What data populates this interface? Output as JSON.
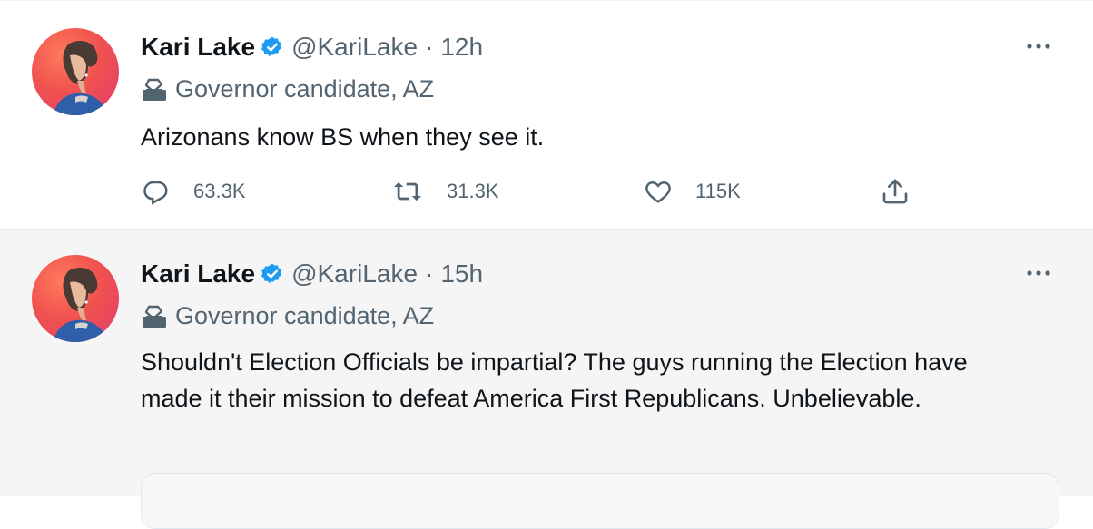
{
  "tweets": [
    {
      "name": "Kari Lake",
      "handle": "@KariLake",
      "separator": "·",
      "time": "12h",
      "label": "Governor candidate, AZ",
      "text": "Arizonans know BS when they see it.",
      "actions": {
        "replies": "63.3K",
        "retweets": "31.3K",
        "likes": "115K"
      }
    },
    {
      "name": "Kari Lake",
      "handle": "@KariLake",
      "separator": "·",
      "time": "15h",
      "label": "Governor candidate, AZ",
      "text": "Shouldn't Election Officials be impartial? The guys running the Election have made it their mission to defeat America First Republicans. Unbelievable."
    }
  ],
  "colors": {
    "verified": "#1d9bf0",
    "secondary_text": "#536471",
    "primary_text": "#0f1419",
    "avatar_background": "#f0524f"
  },
  "icons": [
    "verified-badge-icon",
    "ballot-box-icon",
    "more-icon",
    "reply-icon",
    "retweet-icon",
    "like-icon",
    "share-icon"
  ]
}
